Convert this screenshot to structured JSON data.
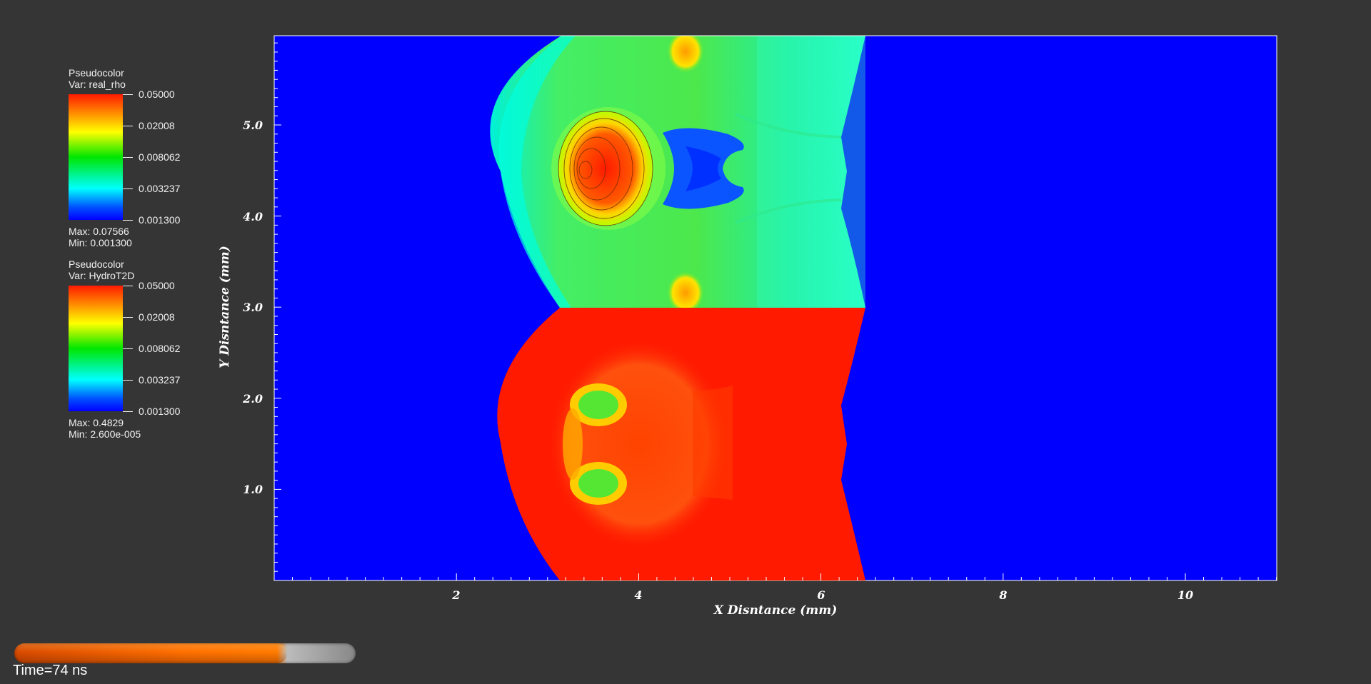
{
  "legends": [
    {
      "title": "Pseudocolor",
      "var": "Var: real_rho",
      "ticks": [
        "0.05000",
        "0.02008",
        "0.008062",
        "0.003237",
        "0.001300"
      ],
      "max": "Max:  0.07566",
      "min": "Min:  0.001300"
    },
    {
      "title": "Pseudocolor",
      "var": "Var: HydroT2D",
      "ticks": [
        "0.05000",
        "0.02008",
        "0.008062",
        "0.003237",
        "0.001300"
      ],
      "max": "Max:  0.4829",
      "min": "Min:  2.600e-005"
    }
  ],
  "plot": {
    "x_label": "X Disntance (mm)",
    "y_label": "Y Disntance (mm)",
    "x_ticks": [
      "2",
      "4",
      "6",
      "8",
      "10"
    ],
    "y_ticks": [
      "5.0",
      "4.0",
      "3.0",
      "2.0",
      "1.0"
    ],
    "colors": {
      "background": "#0000ff",
      "hot": "#ff1a00",
      "shock_green": "#33e633",
      "cyan": "#00ffcc"
    }
  },
  "time": {
    "label": "Time=74 ns",
    "progress": 0.8
  }
}
